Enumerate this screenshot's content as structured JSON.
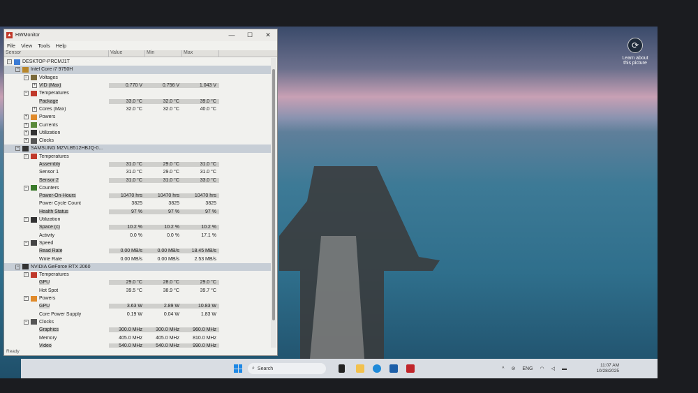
{
  "window": {
    "title": "HWMonitor",
    "minimize": "—",
    "maximize": "☐",
    "close": "✕",
    "status": "Ready"
  },
  "menu": [
    "File",
    "View",
    "Tools",
    "Help"
  ],
  "columns": [
    "Sensor",
    "Value",
    "Min",
    "Max"
  ],
  "rows": [
    {
      "lvl": 0,
      "kind": "root",
      "label": "DESKTOP-PRCMJ1T",
      "exp": "−"
    },
    {
      "lvl": 1,
      "kind": "dev",
      "label": "Intel Core i7 9750H",
      "exp": "−"
    },
    {
      "lvl": 2,
      "kind": "grp",
      "label": "Voltages",
      "exp": "−",
      "icon": "voltage-icon"
    },
    {
      "lvl": 3,
      "kind": "s",
      "label": "VID (Max)",
      "value": "0.770 V",
      "min": "0.756 V",
      "max": "1.043 V",
      "shade": true,
      "exp": "+"
    },
    {
      "lvl": 2,
      "kind": "grp",
      "label": "Temperatures",
      "exp": "−",
      "icon": "thermometer-icon"
    },
    {
      "lvl": 3,
      "kind": "s",
      "label": "Package",
      "value": "33.0 °C",
      "min": "32.0 °C",
      "max": "39.0 °C",
      "shade": true
    },
    {
      "lvl": 3,
      "kind": "s",
      "label": "Cores (Max)",
      "value": "32.0 °C",
      "min": "32.0 °C",
      "max": "40.0 °C",
      "exp": "+"
    },
    {
      "lvl": 2,
      "kind": "grp",
      "label": "Powers",
      "exp": "+",
      "icon": "power-icon"
    },
    {
      "lvl": 2,
      "kind": "grp",
      "label": "Currents",
      "exp": "+",
      "icon": "current-icon"
    },
    {
      "lvl": 2,
      "kind": "grp",
      "label": "Utilization",
      "exp": "+",
      "icon": "utilization-icon"
    },
    {
      "lvl": 2,
      "kind": "grp",
      "label": "Clocks",
      "exp": "+",
      "icon": "clock-icon"
    },
    {
      "lvl": 1,
      "kind": "dev",
      "label": "SAMSUNG MZVLB512HBJQ-0...",
      "exp": "−"
    },
    {
      "lvl": 2,
      "kind": "grp",
      "label": "Temperatures",
      "exp": "−",
      "icon": "thermometer-icon"
    },
    {
      "lvl": 3,
      "kind": "s",
      "label": "Assembly",
      "value": "31.0 °C",
      "min": "29.0 °C",
      "max": "31.0 °C",
      "shade": true
    },
    {
      "lvl": 3,
      "kind": "s",
      "label": "Sensor 1",
      "value": "31.0 °C",
      "min": "29.0 °C",
      "max": "31.0 °C"
    },
    {
      "lvl": 3,
      "kind": "s",
      "label": "Sensor 2",
      "value": "31.0 °C",
      "min": "31.0 °C",
      "max": "33.0 °C",
      "shade": true
    },
    {
      "lvl": 2,
      "kind": "grp",
      "label": "Counters",
      "exp": "−",
      "icon": "counter-icon"
    },
    {
      "lvl": 3,
      "kind": "s",
      "label": "Power-On-Hours",
      "value": "10470 hrs",
      "min": "10470 hrs",
      "max": "10470 hrs",
      "shade": true
    },
    {
      "lvl": 3,
      "kind": "s",
      "label": "Power Cycle Count",
      "value": "3825",
      "min": "3825",
      "max": "3825"
    },
    {
      "lvl": 3,
      "kind": "s",
      "label": "Health Status",
      "value": "97 %",
      "min": "97 %",
      "max": "97 %",
      "shade": true
    },
    {
      "lvl": 2,
      "kind": "grp",
      "label": "Utilization",
      "exp": "−",
      "icon": "utilization-icon"
    },
    {
      "lvl": 3,
      "kind": "s",
      "label": "Space (c)",
      "value": "10.2 %",
      "min": "10.2 %",
      "max": "10.2 %",
      "shade": true
    },
    {
      "lvl": 3,
      "kind": "s",
      "label": "Activity",
      "value": "0.0 %",
      "min": "0.0 %",
      "max": "17.1 %"
    },
    {
      "lvl": 2,
      "kind": "grp",
      "label": "Speed",
      "exp": "−",
      "icon": "speed-icon"
    },
    {
      "lvl": 3,
      "kind": "s",
      "label": "Read Rate",
      "value": "0.00 MB/s",
      "min": "0.00 MB/s",
      "max": "18.45 MB/s",
      "shade": true
    },
    {
      "lvl": 3,
      "kind": "s",
      "label": "Write Rate",
      "value": "0.00 MB/s",
      "min": "0.00 MB/s",
      "max": "2.53 MB/s"
    },
    {
      "lvl": 1,
      "kind": "dev",
      "label": "NVIDIA GeForce RTX 2060",
      "exp": "−"
    },
    {
      "lvl": 2,
      "kind": "grp",
      "label": "Temperatures",
      "exp": "−",
      "icon": "thermometer-icon"
    },
    {
      "lvl": 3,
      "kind": "s",
      "label": "GPU",
      "value": "29.0 °C",
      "min": "28.0 °C",
      "max": "29.0 °C",
      "shade": true
    },
    {
      "lvl": 3,
      "kind": "s",
      "label": "Hot Spot",
      "value": "39.5 °C",
      "min": "38.9 °C",
      "max": "39.7 °C"
    },
    {
      "lvl": 2,
      "kind": "grp",
      "label": "Powers",
      "exp": "−",
      "icon": "power-icon"
    },
    {
      "lvl": 3,
      "kind": "s",
      "label": "GPU",
      "value": "3.63 W",
      "min": "2.89 W",
      "max": "10.83 W",
      "shade": true
    },
    {
      "lvl": 3,
      "kind": "s",
      "label": "Core Power Supply",
      "value": "0.19 W",
      "min": "0.04 W",
      "max": "1.83 W"
    },
    {
      "lvl": 2,
      "kind": "grp",
      "label": "Clocks",
      "exp": "−",
      "icon": "clock-icon"
    },
    {
      "lvl": 3,
      "kind": "s",
      "label": "Graphics",
      "value": "300.0 MHz",
      "min": "300.0 MHz",
      "max": "960.0 MHz",
      "shade": true
    },
    {
      "lvl": 3,
      "kind": "s",
      "label": "Memory",
      "value": "405.0 MHz",
      "min": "405.0 MHz",
      "max": "810.0 MHz"
    },
    {
      "lvl": 3,
      "kind": "s",
      "label": "Video",
      "value": "540.0 MHz",
      "min": "540.0 MHz",
      "max": "990.0 MHz",
      "shade": true
    }
  ],
  "desktop": {
    "learn_line1": "Learn about",
    "learn_line2": "this picture"
  },
  "taskbar": {
    "search_placeholder": "Search",
    "lang": "ENG",
    "time": "11:07 AM",
    "date": "10/28/2025"
  }
}
